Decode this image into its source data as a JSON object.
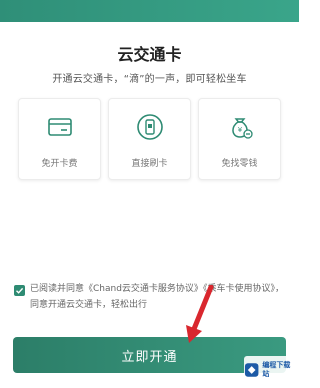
{
  "header": {
    "title": "云交通卡",
    "subtitle": "开通云交通卡，“滴”的一声，即可轻松坐车"
  },
  "features": [
    {
      "label": "免开卡费",
      "icon": "card-icon"
    },
    {
      "label": "直接刷卡",
      "icon": "phone-card-icon"
    },
    {
      "label": "免找零钱",
      "icon": "money-bag-icon"
    }
  ],
  "consent": {
    "checked": true,
    "text_1": "已阅读并同意",
    "link_1": "《Chand云交通卡服务协议》",
    "link_2": "《乘车卡使用协议》",
    "text_2": "，同意开通云交通卡，轻松出行"
  },
  "action": {
    "open_label": "立即开通"
  },
  "watermark": {
    "text": "编程下载站"
  },
  "colors": {
    "accent": "#2e8b73",
    "arrow": "#d9272e"
  }
}
